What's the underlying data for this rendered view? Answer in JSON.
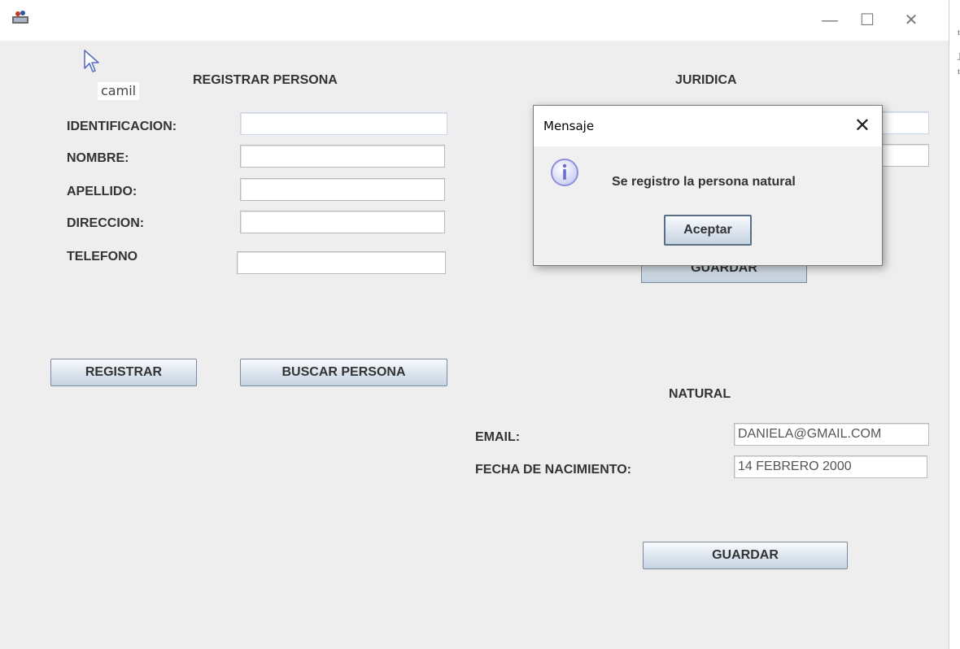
{
  "window": {
    "minimize": "—",
    "maximize": "☐",
    "close": "✕",
    "edge_glyphs": [
      "t",
      "J",
      "t"
    ]
  },
  "tooltip": {
    "text": "camil"
  },
  "registrar": {
    "title": "REGISTRAR PERSONA",
    "fields": [
      {
        "label": "IDENTIFICACION:",
        "value": ""
      },
      {
        "label": "NOMBRE:",
        "value": ""
      },
      {
        "label": "APELLIDO:",
        "value": ""
      },
      {
        "label": "DIRECCION:",
        "value": ""
      },
      {
        "label": "TELEFONO",
        "value": ""
      }
    ],
    "register_button": "REGISTRAR",
    "search_button": "BUSCAR PERSONA"
  },
  "juridica": {
    "title": "JURIDICA",
    "field_1_value": "",
    "field_2_value": "",
    "save_button": "GUARDAR"
  },
  "natural": {
    "title": "NATURAL",
    "email_label": "EMAIL:",
    "email_value": "DANIELA@GMAIL.COM",
    "birth_label": "FECHA DE NACIMIENTO:",
    "birth_value": "14 FEBRERO 2000",
    "save_button": "GUARDAR"
  },
  "dialog": {
    "title": "Mensaje",
    "close": "✕",
    "message": "Se registro la persona natural",
    "ok_button": "Aceptar",
    "icon": "info-icon"
  },
  "colors": {
    "window_bg": "#eeeeee",
    "button_gradient_top": "#f9fbfd",
    "button_gradient_bottom": "#c6d3e1",
    "info_icon": "#8a8fd8"
  }
}
